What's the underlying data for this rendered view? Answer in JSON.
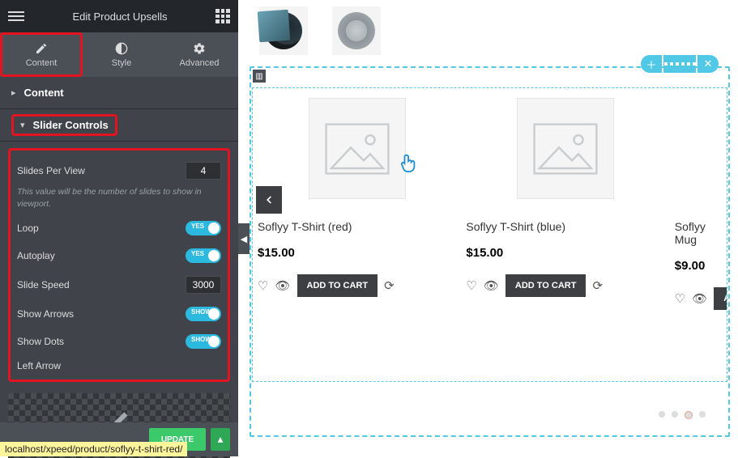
{
  "header": {
    "title": "Edit Product Upsells"
  },
  "tabs": {
    "content": "Content",
    "style": "Style",
    "advanced": "Advanced"
  },
  "sections": {
    "content_section": "Content",
    "slider_controls": "Slider Controls"
  },
  "fields": {
    "slides_per_view": {
      "label": "Slides Per View",
      "value": "4"
    },
    "help": "This value will be the number of slides to show in viewport.",
    "loop": {
      "label": "Loop",
      "on": "YES"
    },
    "autoplay": {
      "label": "Autoplay",
      "on": "YES"
    },
    "slide_speed": {
      "label": "Slide Speed",
      "value": "3000"
    },
    "show_arrows": {
      "label": "Show Arrows",
      "on": "SHOW"
    },
    "show_dots": {
      "label": "Show Dots",
      "on": "SHOW"
    },
    "left_arrow": "Left Arrow"
  },
  "buttons": {
    "update": "UPDATE"
  },
  "status_url": "localhost/xpeed/product/soflyy-t-shirt-red/",
  "products": [
    {
      "title": "Soflyy T-Shirt (red)",
      "price": "$15.00",
      "cta": "ADD TO CART"
    },
    {
      "title": "Soflyy T-Shirt (blue)",
      "price": "$15.00",
      "cta": "ADD TO CART"
    },
    {
      "title": "Soflyy Mug",
      "price": "$9.00",
      "cta": "AD"
    }
  ]
}
